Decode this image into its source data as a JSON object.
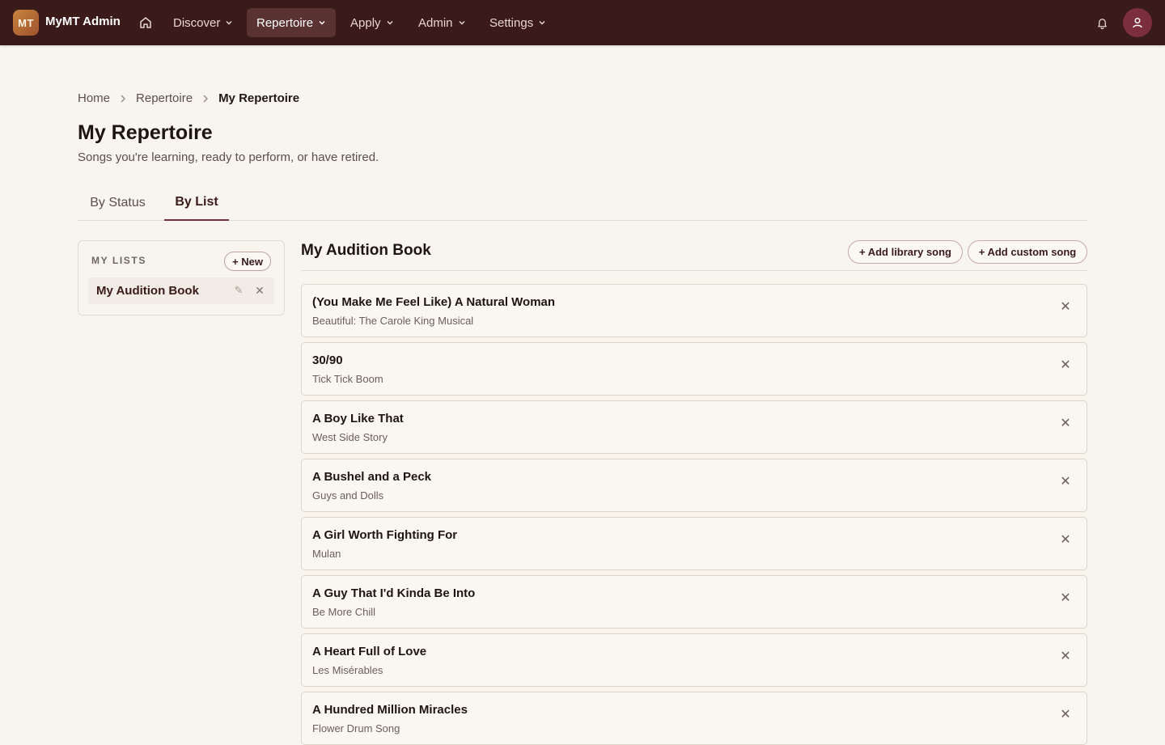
{
  "app": {
    "logo_initials": "MT",
    "brand": "MyMT Admin"
  },
  "nav": {
    "items": [
      {
        "label": "Discover"
      },
      {
        "label": "Repertoire"
      },
      {
        "label": "Apply"
      },
      {
        "label": "Admin"
      },
      {
        "label": "Settings"
      }
    ],
    "active_item": "Repertoire"
  },
  "breadcrumb": {
    "items": [
      "Home",
      "Repertoire"
    ],
    "current": "My Repertoire"
  },
  "page": {
    "title": "My Repertoire",
    "subtitle": "Songs you're learning, ready to perform, or have retired."
  },
  "tabs": {
    "items": [
      {
        "label": "By Status"
      },
      {
        "label": "By List"
      }
    ],
    "active_tab": "By List"
  },
  "sidebar": {
    "heading": "MY LISTS",
    "new_button": "+ New",
    "lists": [
      {
        "label": "My Audition Book"
      }
    ]
  },
  "main": {
    "list_title": "My Audition Book",
    "add_library_button": "+ Add library song",
    "add_custom_button": "+ Add custom song",
    "songs": [
      {
        "title": "(You Make Me Feel Like) A Natural Woman",
        "show": "Beautiful: The Carole King Musical"
      },
      {
        "title": "30/90",
        "show": "Tick Tick Boom"
      },
      {
        "title": "A Boy Like That",
        "show": "West Side Story"
      },
      {
        "title": "A Bushel and a Peck",
        "show": "Guys and Dolls"
      },
      {
        "title": "A Girl Worth Fighting For",
        "show": "Mulan"
      },
      {
        "title": "A Guy That I'd Kinda Be Into",
        "show": "Be More Chill"
      },
      {
        "title": "A Heart Full of Love",
        "show": "Les Misérables"
      },
      {
        "title": "A Hundred Million Miracles",
        "show": "Flower Drum Song"
      }
    ]
  },
  "icons": {
    "home": "home-icon",
    "bell": "bell-icon",
    "user": "user-icon",
    "chevron": "chevron-down-icon",
    "breadcrumb_separator": "chevron-right-icon",
    "remove": "close-icon",
    "edit": "pencil-icon"
  },
  "colors": {
    "topbar": "#3b1a1a",
    "accent": "#7a2e3e",
    "background": "#f8f5ef"
  }
}
